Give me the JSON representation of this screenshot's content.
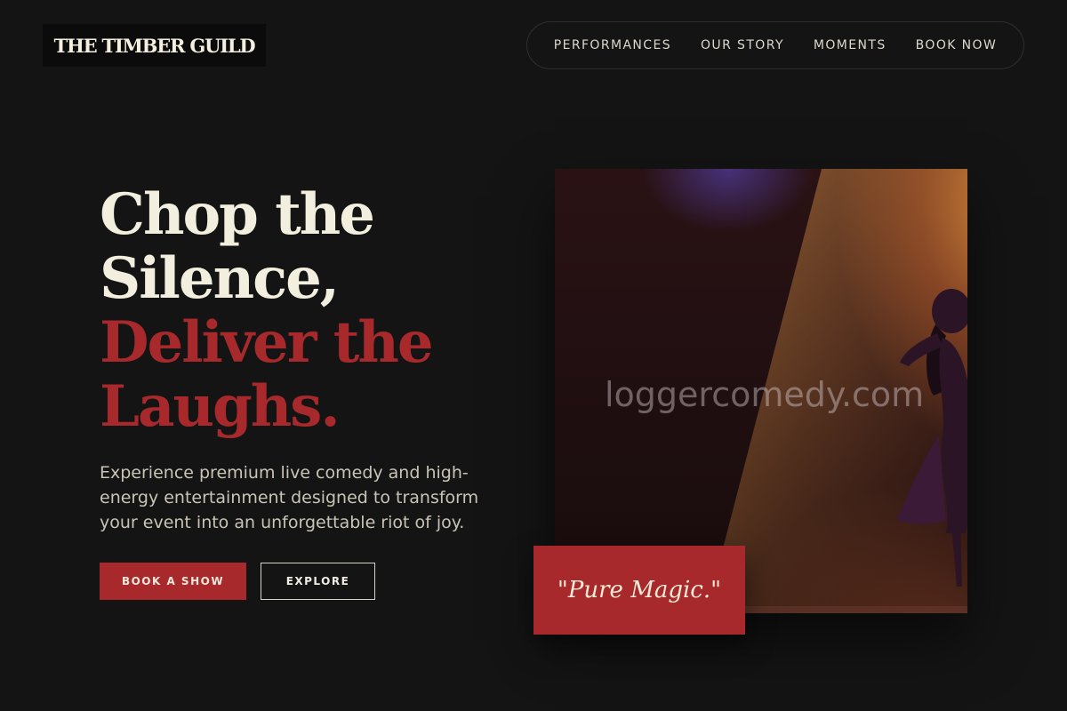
{
  "brand": {
    "logo_text": "THE TIMBER GUILD"
  },
  "nav": {
    "items": [
      "PERFORMANCES",
      "OUR STORY",
      "MOMENTS",
      "BOOK NOW"
    ]
  },
  "hero": {
    "title_lines": [
      "Chop the",
      "Silence,"
    ],
    "accent_lines": [
      "Deliver the",
      "Laughs."
    ],
    "description": "Experience premium live comedy and high-energy entertainment designed to transform your event into an unforgettable riot of joy.",
    "primary_button": "BOOK A SHOW",
    "secondary_button": "EXPLORE"
  },
  "media": {
    "watermark": "loggercomedy.com",
    "quote": "\"Pure Magic.\""
  },
  "colors": {
    "background": "#141414",
    "accent": "#a8292b",
    "cream": "#f3efde"
  }
}
